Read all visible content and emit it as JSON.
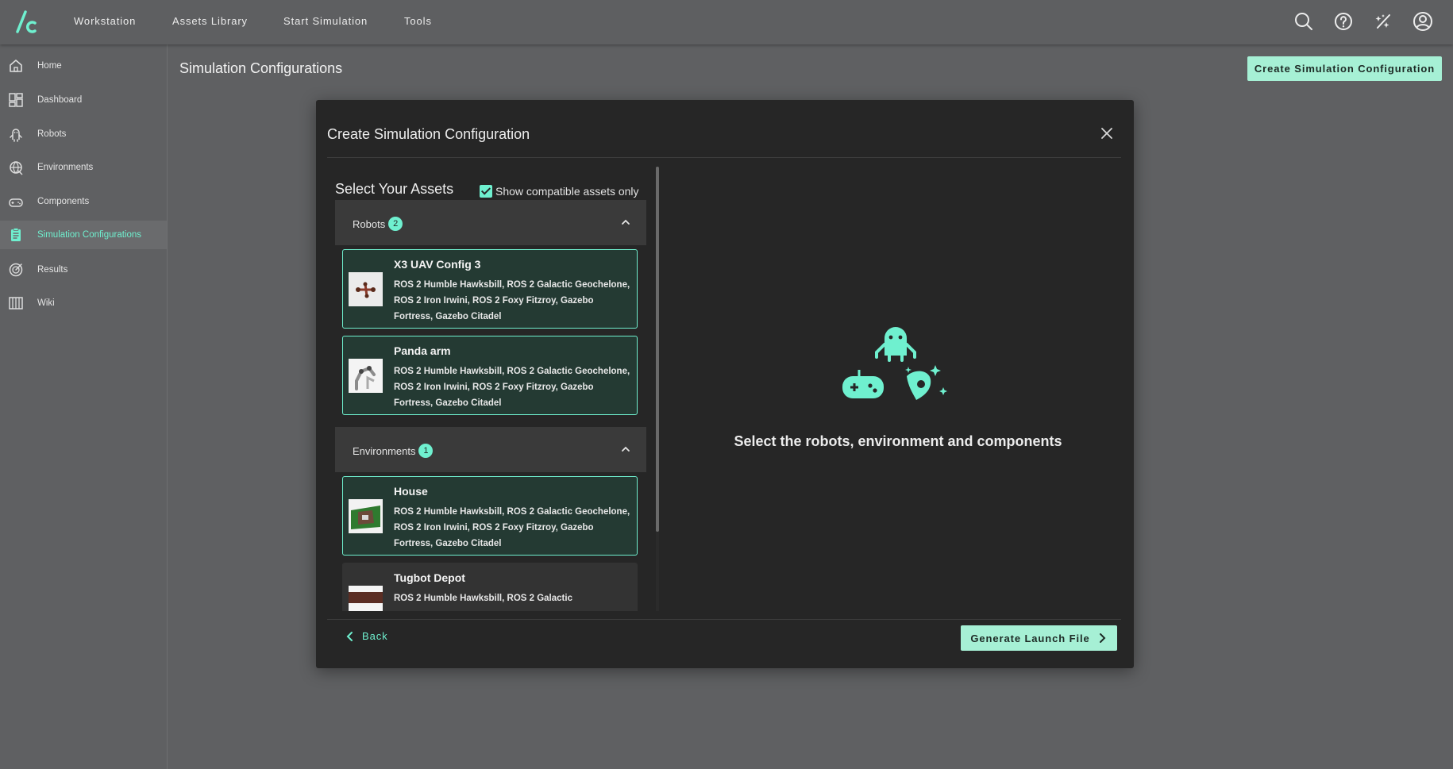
{
  "topnav": {
    "items": [
      {
        "label": "Workstation"
      },
      {
        "label": "Assets Library"
      },
      {
        "label": "Start Simulation"
      },
      {
        "label": "Tools"
      }
    ],
    "icons": [
      "search-icon",
      "help-icon",
      "theme-toggle-icon",
      "account-icon"
    ]
  },
  "sidebar": {
    "items": [
      {
        "label": "Home",
        "icon": "home-icon"
      },
      {
        "label": "Dashboard",
        "icon": "dashboard-icon"
      },
      {
        "label": "Robots",
        "icon": "robot-icon"
      },
      {
        "label": "Environments",
        "icon": "environment-icon"
      },
      {
        "label": "Components",
        "icon": "controller-icon"
      },
      {
        "label": "Simulation Configurations",
        "icon": "clipboard-icon",
        "active": true
      },
      {
        "label": "Results",
        "icon": "results-icon"
      },
      {
        "label": "Wiki",
        "icon": "wiki-icon"
      }
    ]
  },
  "page": {
    "title": "Simulation Configurations",
    "create_button": "Create Simulation Configuration"
  },
  "modal": {
    "title": "Create Simulation Configuration",
    "assets_title": "Select Your Assets",
    "compatible_label": "Show compatible assets only",
    "compatible_checked": true,
    "robots": {
      "label": "Robots",
      "count": "2",
      "cards": [
        {
          "name": "X3 UAV Config 3",
          "desc": "ROS 2 Humble Hawksbill, ROS 2 Galactic Geochelone, ROS 2 Iron Irwini, ROS 2 Foxy Fitzroy, Gazebo Fortress, Gazebo Citadel",
          "selected": true
        },
        {
          "name": "Panda arm",
          "desc": "ROS 2 Humble Hawksbill, ROS 2 Galactic Geochelone, ROS 2 Iron Irwini, ROS 2 Foxy Fitzroy, Gazebo Fortress, Gazebo Citadel",
          "selected": true
        }
      ]
    },
    "environments": {
      "label": "Environments",
      "count": "1",
      "cards": [
        {
          "name": "House",
          "desc": "ROS 2 Humble Hawksbill, ROS 2 Galactic Geochelone, ROS 2 Iron Irwini, ROS 2 Foxy Fitzroy, Gazebo Fortress, Gazebo Citadel",
          "selected": true
        },
        {
          "name": "Tugbot Depot",
          "desc": "ROS 2 Humble Hawksbill, ROS 2 Galactic",
          "selected": false
        }
      ]
    },
    "empty_state": "Select the robots, environment and components",
    "back_label": "Back",
    "generate_label": "Generate Launch File"
  },
  "colors": {
    "accent": "#6ff0cf",
    "button_bg": "#a6f0d5",
    "page_bg": "#5f6062",
    "modal_bg": "#262626",
    "selected_card_bg": "#243a33"
  }
}
